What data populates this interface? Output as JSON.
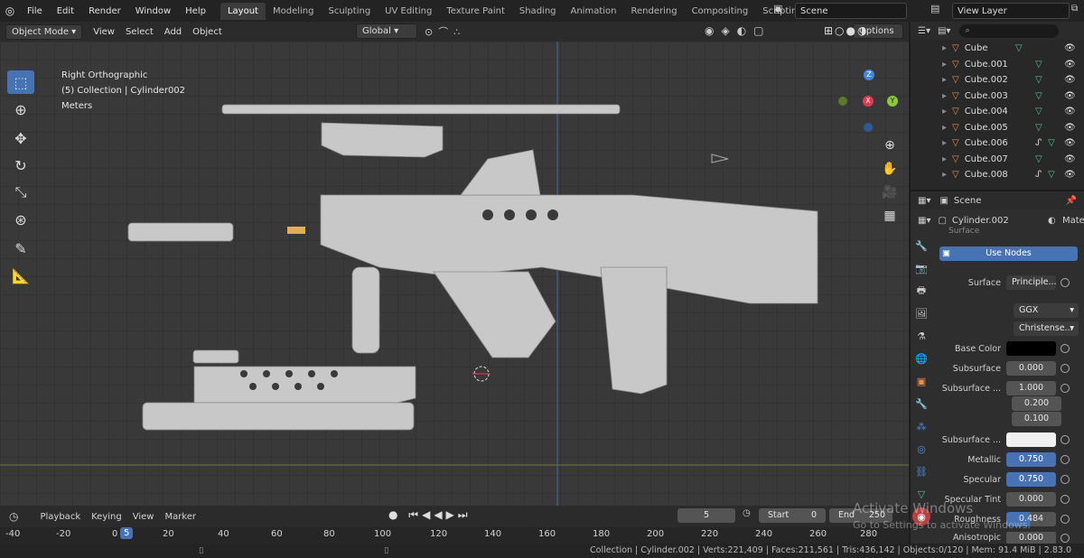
{
  "topbar": {
    "menus": [
      "File",
      "Edit",
      "Render",
      "Window",
      "Help"
    ],
    "workspaces": [
      "Layout",
      "Modeling",
      "Sculpting",
      "UV Editing",
      "Texture Paint",
      "Shading",
      "Animation",
      "Rendering",
      "Compositing",
      "Scripting"
    ],
    "add_tab": "+",
    "scene": "Scene",
    "view_layer": "View Layer"
  },
  "viewport_header": {
    "mode": "Object Mode",
    "menus": [
      "View",
      "Select",
      "Add",
      "Object"
    ],
    "transform": "Global",
    "options": "Options"
  },
  "overlay": {
    "view_name": "Right Orthographic",
    "collection": "(5) Collection | Cylinder002",
    "units": "Meters"
  },
  "gizmo": {
    "z": "Z",
    "y": "Y",
    "x": "X"
  },
  "outliner": {
    "items": [
      "Cube",
      "Cube.001",
      "Cube.002",
      "Cube.003",
      "Cube.004",
      "Cube.005",
      "Cube.006",
      "Cube.007",
      "Cube.008"
    ]
  },
  "properties": {
    "scene_label": "Scene",
    "object": "Cylinder.002",
    "material_tab": "Mate",
    "section": "Surface",
    "use_nodes": "Use Nodes",
    "surface_label": "Surface",
    "surface_value": "Principle...",
    "distribution": "GGX",
    "subsurface_method": "Christense...",
    "base_color_label": "Base Color",
    "subsurface_label": "Subsurface",
    "subsurface_value": "0.000",
    "subsurface_radius_label": "Subsurface ...",
    "radius": [
      "1.000",
      "0.200",
      "0.100"
    ],
    "subsurface_color_label": "Subsurface ...",
    "metallic_label": "Metallic",
    "metallic_value": "0.750",
    "specular_label": "Specular",
    "specular_value": "0.750",
    "specular_tint_label": "Specular Tint",
    "specular_tint_value": "0.000",
    "roughness_label": "Roughness",
    "roughness_value": "0.484",
    "anisotropic_label": "Anisotropic",
    "anisotropic_value": "0.000",
    "metallic_fraction": 0.75,
    "roughness_fraction": 0.484
  },
  "timeline": {
    "menus": [
      "Playback",
      "Keying",
      "View",
      "Marker"
    ],
    "current_frame": "5",
    "start_label": "Start",
    "start": "0",
    "end_label": "End",
    "end": "250",
    "ruler": [
      "-40",
      "-20",
      "0",
      "5",
      "20",
      "40",
      "60",
      "80",
      "100",
      "120",
      "140",
      "160",
      "180",
      "200",
      "220",
      "240",
      "260",
      "280"
    ]
  },
  "statusbar": {
    "text": "Collection | Cylinder.002 | Verts:221,409 | Faces:211,561 | Tris:436,142 | Objects:0/120 | Mem: 91.4 MiB | 2.83.0"
  },
  "watermark": {
    "title": "Activate Windows",
    "subtitle": "Go to Settings to activate Windows."
  },
  "colors": {
    "accent": "#4772b3",
    "viewport_bg": "#393939",
    "model": "#c8c8c8",
    "axis_x": "#e03c4f",
    "axis_y": "#8bc83a",
    "axis_z": "#3f87e0"
  }
}
